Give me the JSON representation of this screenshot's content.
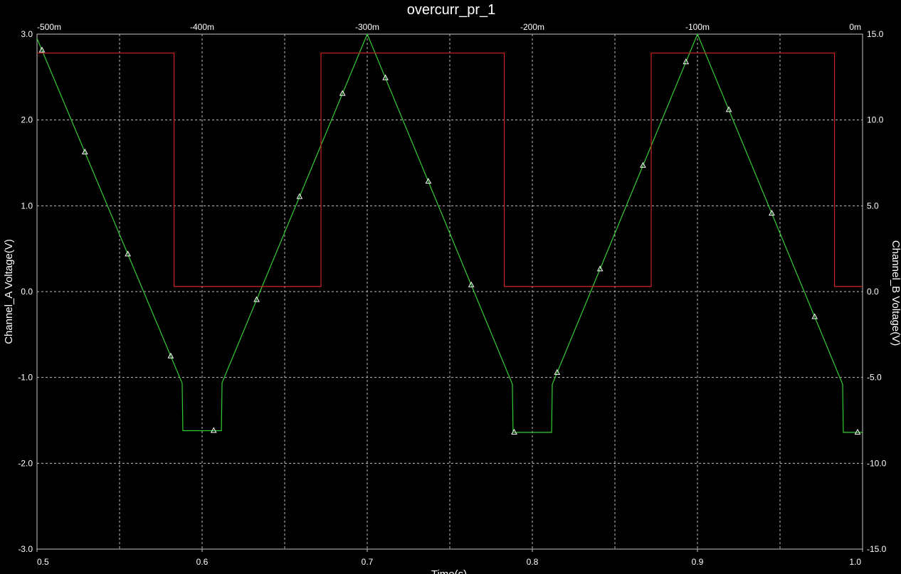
{
  "chart_data": {
    "type": "line",
    "title": "overcurr_pr_1",
    "xlabel": "Time(s)",
    "ylabel_left": "Channel_A Voltage(V)",
    "ylabel_right": "Channel_B Voltage(V)",
    "xlim": [
      0.5,
      1.0
    ],
    "x_ticks": [
      "0.5",
      "0.6",
      "0.7",
      "0.8",
      "0.9",
      "1.0"
    ],
    "x_top_ticks": [
      "-500m",
      "-400m",
      "-300m",
      "-200m",
      "-100m",
      "0m"
    ],
    "ylim_left": [
      -3.0,
      3.0
    ],
    "y_left_ticks": [
      "3.0",
      "2.0",
      "1.0",
      "0.0",
      "-1.0",
      "-2.0",
      "-3.0"
    ],
    "ylim_right": [
      -15.0,
      15.0
    ],
    "y_right_ticks": [
      "15.0",
      "10.0",
      "5.0",
      "0.0",
      "-5.0",
      "-10.0",
      "-15.0"
    ],
    "grid": true,
    "background": "#000000",
    "series": [
      {
        "axis": "left",
        "color": "#33cc33",
        "marker": "triangle",
        "x": [
          0.5,
          0.6,
          0.7,
          0.8,
          0.9,
          1.0
        ],
        "y": [
          2.95,
          -1.62,
          3.0,
          -1.64,
          3.0,
          -1.64
        ],
        "trough_rounding": 0.012,
        "markers_x": [
          0.503,
          0.529,
          0.555,
          0.581,
          0.607,
          0.633,
          0.659,
          0.685,
          0.711,
          0.737,
          0.763,
          0.789,
          0.815,
          0.841,
          0.867,
          0.893,
          0.919,
          0.945,
          0.971,
          0.997
        ]
      },
      {
        "axis": "right",
        "color": "#cc2222",
        "x": [
          0.5,
          0.583,
          0.583,
          0.672,
          0.672,
          0.783,
          0.783,
          0.872,
          0.872,
          0.983,
          0.983,
          1.0
        ],
        "y": [
          13.9,
          13.9,
          0.3,
          0.3,
          13.9,
          13.9,
          0.3,
          0.3,
          13.9,
          13.9,
          0.3,
          0.3
        ]
      }
    ]
  }
}
